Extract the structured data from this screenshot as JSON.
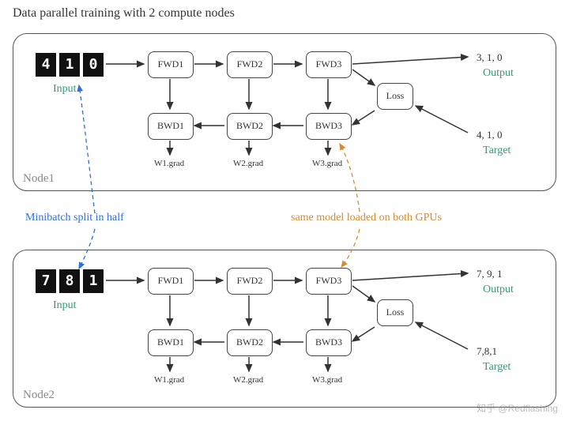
{
  "title": "Data parallel training with 2 compute nodes",
  "annotations": {
    "minibatch": "Minibatch split in half",
    "same_model": "same model loaded on both GPUs"
  },
  "watermark": "知乎 @Redflashing",
  "nodes": [
    {
      "name": "Node1",
      "input_digits": [
        "4",
        "1",
        "0"
      ],
      "input_label": "Input",
      "fwd": [
        "FWD1",
        "FWD2",
        "FWD3"
      ],
      "bwd": [
        "BWD1",
        "BWD2",
        "BWD3"
      ],
      "loss": "Loss",
      "grads": [
        "W1.grad",
        "W2.grad",
        "W3.grad"
      ],
      "output": "3, 1, 0",
      "output_label": "Output",
      "target": "4, 1, 0",
      "target_label": "Target"
    },
    {
      "name": "Node2",
      "input_digits": [
        "7",
        "8",
        "1"
      ],
      "input_label": "Input",
      "fwd": [
        "FWD1",
        "FWD2",
        "FWD3"
      ],
      "bwd": [
        "BWD1",
        "BWD2",
        "BWD3"
      ],
      "loss": "Loss",
      "grads": [
        "W1.grad",
        "W2.grad",
        "W3.grad"
      ],
      "output": "7, 9, 1",
      "output_label": "Output",
      "target": "7,8,1",
      "target_label": "Target"
    }
  ]
}
